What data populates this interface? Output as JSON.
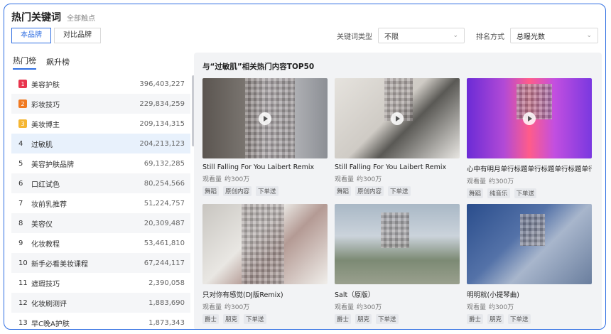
{
  "header": {
    "title": "热门关键词",
    "subtitle": "全部触点"
  },
  "brand_toggle": {
    "primary": "本品牌",
    "compare": "对比品牌"
  },
  "filters": {
    "keyword_type_label": "关键词类型",
    "keyword_type_value": "不限",
    "sort_label": "排名方式",
    "sort_value": "总曝光数"
  },
  "colors": {
    "accent": "#2f6ee2",
    "rank1": "#e8354d",
    "rank2": "#f07a22",
    "rank3": "#f5b633"
  },
  "tabs": [
    {
      "label": "热门榜"
    },
    {
      "label": "飙升榜"
    }
  ],
  "rankings": [
    {
      "rank": "1",
      "keyword": "美容护肤",
      "value": "396,403,227"
    },
    {
      "rank": "2",
      "keyword": "彩妆技巧",
      "value": "229,834,259"
    },
    {
      "rank": "3",
      "keyword": "美妆博主",
      "value": "209,134,315"
    },
    {
      "rank": "4",
      "keyword": "过敏肌",
      "value": "204,213,123"
    },
    {
      "rank": "5",
      "keyword": "美容护肤品牌",
      "value": "69,132,285"
    },
    {
      "rank": "6",
      "keyword": "口红试色",
      "value": "80,254,566"
    },
    {
      "rank": "7",
      "keyword": "妆前乳推荐",
      "value": "51,224,757"
    },
    {
      "rank": "8",
      "keyword": "美容仪",
      "value": "20,309,487"
    },
    {
      "rank": "9",
      "keyword": "化妆教程",
      "value": "53,461,810"
    },
    {
      "rank": "10",
      "keyword": "新手必看美妆课程",
      "value": "67,244,117"
    },
    {
      "rank": "11",
      "keyword": "遮瑕技巧",
      "value": "2,390,058"
    },
    {
      "rank": "12",
      "keyword": "化妆刷测评",
      "value": "1,883,690"
    },
    {
      "rank": "13",
      "keyword": "早C晚A护肤",
      "value": "1,873,343"
    }
  ],
  "content": {
    "title": "与“过敏肌”相关热门内容TOP50",
    "cards": [
      {
        "title": "Still Falling For You Laibert Remix",
        "views_label": "观看量",
        "views": "约300万",
        "tags": [
          "舞蹈",
          "原创内容",
          "下单送"
        ]
      },
      {
        "title": "Still Falling For You Laibert Remix",
        "views_label": "观看量",
        "views": "约300万",
        "tags": [
          "舞蹈",
          "原创内容",
          "下单送"
        ]
      },
      {
        "title": "心中有明月单行标题单行标题单行标题单行标题",
        "views_label": "观看量",
        "views": "约300万",
        "tags": [
          "舞蹈",
          "纯音乐",
          "下单送"
        ]
      },
      {
        "title": "只对你有感觉(DJ版Remix)",
        "views_label": "观看量",
        "views": "约300万",
        "tags": [
          "爵士",
          "朋克",
          "下单送"
        ]
      },
      {
        "title": "Salt（原版）",
        "views_label": "观看量",
        "views": "约300万",
        "tags": [
          "爵士",
          "朋克",
          "下单送"
        ]
      },
      {
        "title": "明明就(小提琴曲)",
        "views_label": "观看量",
        "views": "约300万",
        "tags": [
          "爵士",
          "朋克",
          "下单送"
        ]
      }
    ]
  }
}
